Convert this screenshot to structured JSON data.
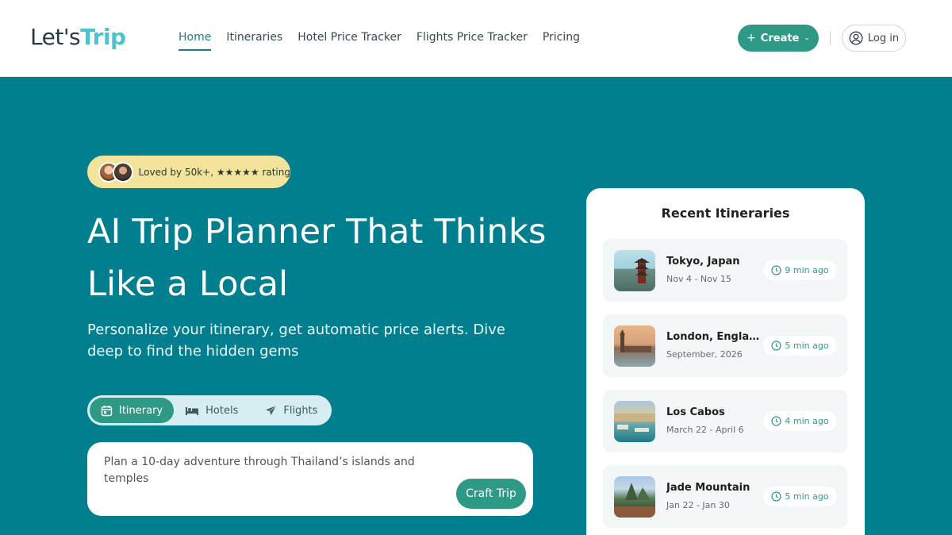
{
  "header": {
    "logo_part1": "Let's",
    "logo_part2": "Trip",
    "nav": [
      "Home",
      "Itineraries",
      "Hotel Price Tracker",
      "Flights Price Tracker",
      "Pricing"
    ],
    "active_nav": "Home",
    "create_label": "Create",
    "login_label": "Log in"
  },
  "hero": {
    "rating_text": "Loved by 50k+, ★★★★★ rating",
    "title_line1": "AI Trip Planner That Thinks",
    "title_line2": "Like a Local",
    "subtitle": "Personalize your itinerary, get automatic price alerts. Dive deep to find the hidden gems",
    "tabs": [
      "Itinerary",
      "Hotels",
      "Flights"
    ],
    "active_tab": "Itinerary",
    "prompt_text": "Plan a 10-day adventure through Thailand’s islands and temples",
    "craft_button": "Craft Trip"
  },
  "recent": {
    "title": "Recent Itineraries",
    "items": [
      {
        "name": "Tokyo, Japan",
        "date": "Nov 4 - Nov 15",
        "ago": "9 min ago"
      },
      {
        "name": "London, England",
        "date": "September, 2026",
        "ago": "5 min ago"
      },
      {
        "name": "Los Cabos",
        "date": "March 22 - April 6",
        "ago": "4 min ago"
      },
      {
        "name": "Jade Mountain",
        "date": "Jan 22 - Jan 30",
        "ago": "5 min ago"
      }
    ]
  },
  "colors": {
    "hero_bg": "#017f8f",
    "accent": "#2e9a86",
    "badge_bg": "#f4e39a",
    "logo_accent": "#4cc3cf"
  },
  "icons": {
    "create": "plus-icon",
    "create_dropdown": "chevron-down-icon",
    "login": "user-circle-icon",
    "tab_itinerary": "calendar-icon",
    "tab_hotels": "bed-icon",
    "tab_flights": "airplane-icon",
    "ago": "clock-icon"
  }
}
